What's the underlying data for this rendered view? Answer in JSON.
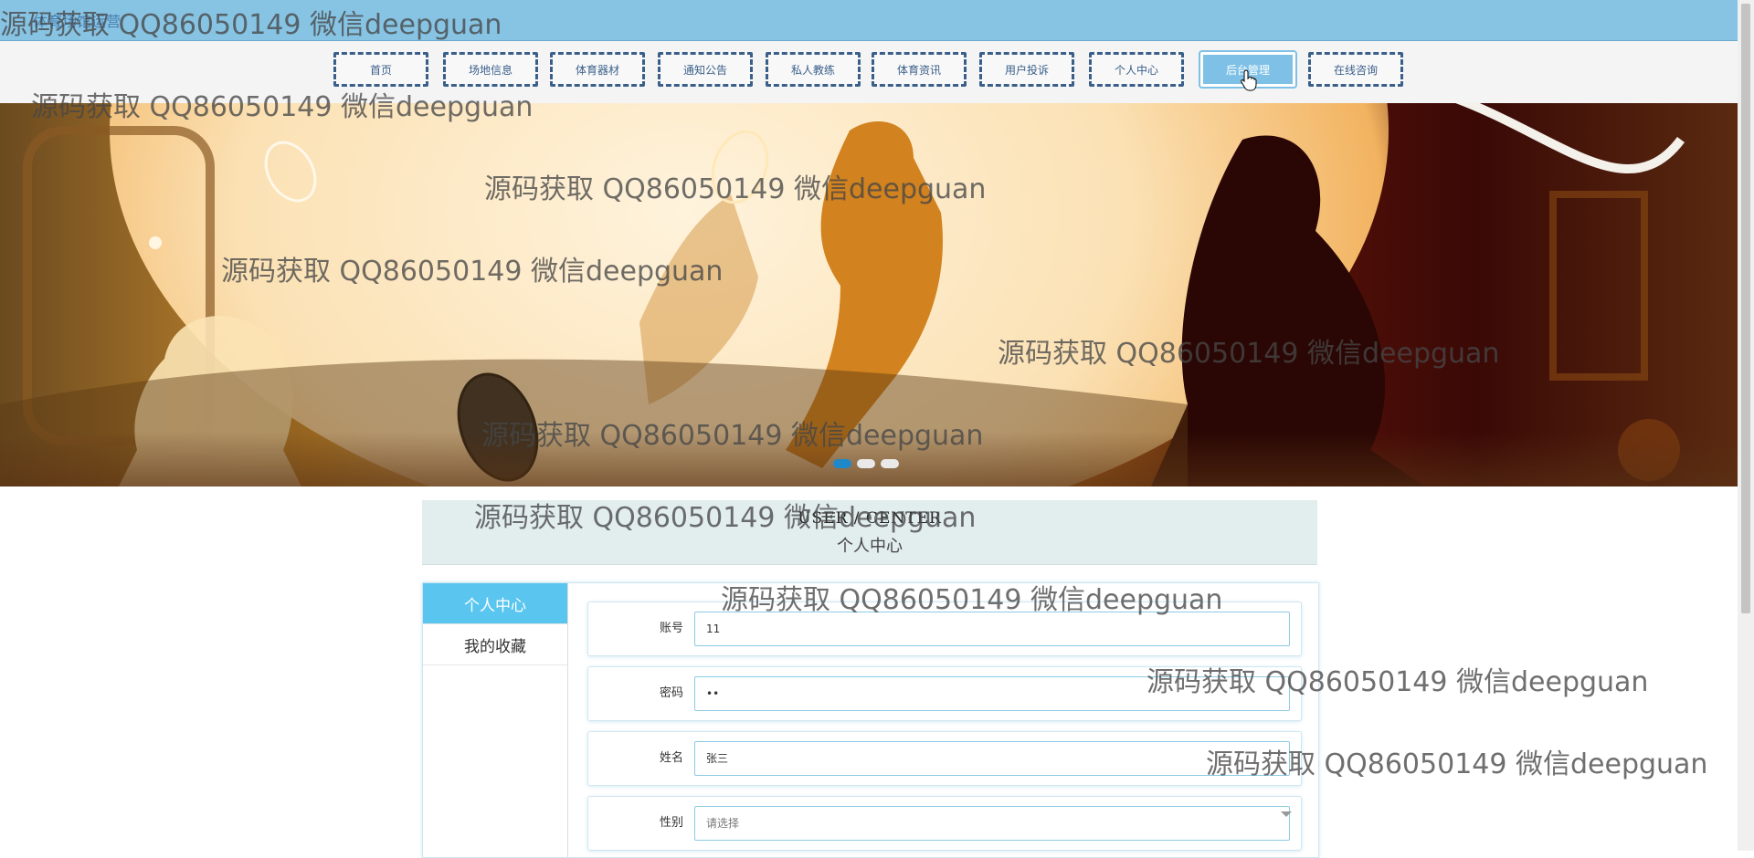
{
  "site_title": "体育场馆运营",
  "nav": {
    "items": [
      {
        "label": "首页"
      },
      {
        "label": "场地信息"
      },
      {
        "label": "体育器材"
      },
      {
        "label": "通知公告"
      },
      {
        "label": "私人教练"
      },
      {
        "label": "体育资讯"
      },
      {
        "label": "用户投诉"
      },
      {
        "label": "个人中心"
      },
      {
        "label": "后台管理",
        "active": true
      },
      {
        "label": "在线咨询"
      }
    ]
  },
  "banner": {
    "slides": 3,
    "active_slide": 1
  },
  "user_center": {
    "title_en": "USER / CENTER",
    "title_cn": "个人中心"
  },
  "sidebar": {
    "items": [
      {
        "label": "个人中心",
        "active": true
      },
      {
        "label": "我的收藏"
      }
    ]
  },
  "form": {
    "account": {
      "label": "账号",
      "value": "11"
    },
    "password": {
      "label": "密码",
      "value": "••"
    },
    "name": {
      "label": "姓名",
      "value": "张三"
    },
    "gender": {
      "label": "性别",
      "value": "请选择"
    }
  },
  "watermark": "源码获取 QQ86050149 微信deepguan",
  "colors": {
    "topbar": "#87c4e4",
    "nav_border": "#3a5f8a",
    "active": "#7fc1e6",
    "sidebar_active": "#5ac6ef"
  }
}
